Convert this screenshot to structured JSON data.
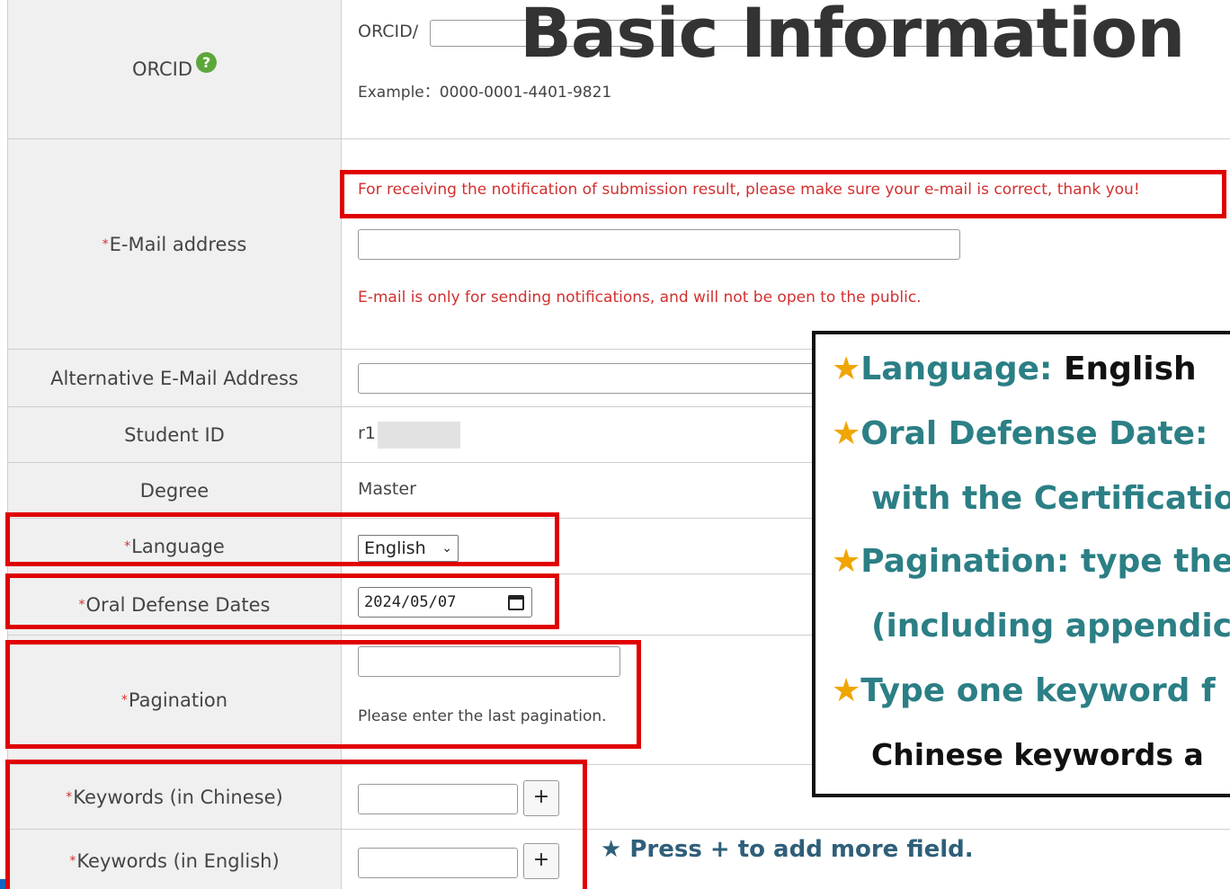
{
  "title": "Basic Information",
  "form": {
    "orcid": {
      "label": "ORCID",
      "help_icon": "question-circle-icon",
      "prefix": "ORCID/",
      "example": "Example：0000-0001-4401-9821",
      "value": ""
    },
    "email": {
      "label": "E-Mail address",
      "required_mark": "*",
      "notice": "For receiving the notification of submission result, please make sure your e-mail is correct, thank you!",
      "value": "",
      "privacy_note": "E-mail is only for sending notifications, and will not be open to the public."
    },
    "alt_email": {
      "label": "Alternative E-Mail Address",
      "value": ""
    },
    "student_id": {
      "label": "Student ID",
      "value": "r1"
    },
    "degree": {
      "label": "Degree",
      "value": "Master"
    },
    "language": {
      "label": "Language",
      "required_mark": "*",
      "selected": "English"
    },
    "oral_defense": {
      "label": "Oral Defense Dates",
      "required_mark": "*",
      "value": "2024/05/07",
      "icon": "calendar-icon"
    },
    "pagination": {
      "label": "Pagination",
      "required_mark": "*",
      "value": "",
      "hint": "Please enter the last pagination."
    },
    "keywords_zh": {
      "label": "Keywords (in Chinese)",
      "required_mark": "*",
      "value": "",
      "add_label": "+"
    },
    "keywords_en": {
      "label": "Keywords (in English)",
      "required_mark": "*",
      "value": "",
      "add_label": "+"
    }
  },
  "annotations": {
    "info_lines": [
      {
        "star": "★",
        "text": "Language: ",
        "emph": "English"
      },
      {
        "star": "★",
        "text": "Oral Defense Date: ",
        "emph": ""
      },
      {
        "star": "",
        "text": "with the Certification",
        "emph": ""
      },
      {
        "star": "★",
        "text": "Pagination: type the",
        "emph": ""
      },
      {
        "star": "",
        "text": "(including appendic",
        "emph": ""
      },
      {
        "star": "★",
        "text": "Type one keyword f",
        "emph": ""
      },
      {
        "star": "",
        "text": "Chinese keywords a",
        "emph": ""
      }
    ],
    "press_note": "★ Press + to add more field."
  },
  "colors": {
    "highlight": "#e00000",
    "note_teal": "#2b7f85",
    "star": "#f0a500",
    "required": "#d32f2f"
  }
}
